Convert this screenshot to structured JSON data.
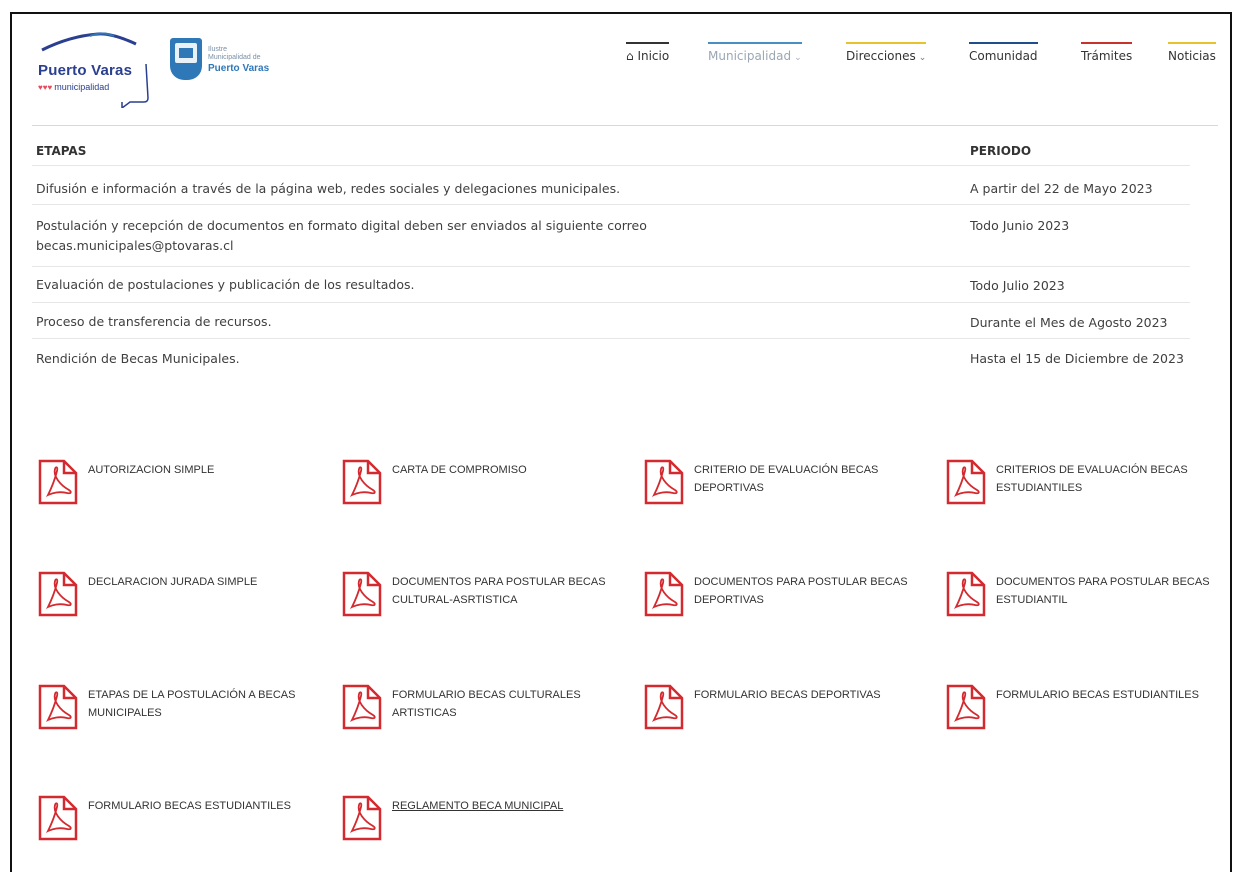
{
  "header": {
    "logo1": {
      "name": "Puerto Varas",
      "sub": "municipalidad"
    },
    "logo2": {
      "line1": "Ilustre",
      "line2": "Municipalidad de",
      "name": "Puerto Varas"
    },
    "nav": [
      {
        "label": "Inicio",
        "icon": "home-icon",
        "color": "#333333"
      },
      {
        "label": "Municipalidad",
        "dropdown": true,
        "color": "#4a8fc4"
      },
      {
        "label": "Direcciones",
        "dropdown": true,
        "color": "#e6c32a"
      },
      {
        "label": "Comunidad",
        "color": "#1f4e8c"
      },
      {
        "label": "Trámites",
        "color": "#c8322b"
      },
      {
        "label": "Noticias",
        "color": "#e6c32a"
      }
    ]
  },
  "table": {
    "headers": {
      "stages": "ETAPAS",
      "period": "PERIODO"
    },
    "rows": [
      {
        "stage": "Difusión e información a través de la página web, redes sociales y delegaciones municipales.",
        "period": "A partir del 22 de Mayo 2023"
      },
      {
        "stage": "Postulación y recepción de documentos en formato digital deben ser enviados al siguiente correo becas.municipales@ptovaras.cl",
        "period": "Todo Junio 2023"
      },
      {
        "stage": "Evaluación de postulaciones y publicación de los resultados.",
        "period": "Todo Julio 2023"
      },
      {
        "stage": "Proceso de transferencia de recursos.",
        "period": "Durante el Mes de Agosto 2023"
      },
      {
        "stage": "Rendición de Becas Municipales.",
        "period": "Hasta el 15 de Diciembre de 2023"
      }
    ]
  },
  "documents": [
    "AUTORIZACION SIMPLE",
    "CARTA DE COMPROMISO",
    "CRITERIO DE EVALUACIÓN BECAS DEPORTIVAS",
    "CRITERIOS DE EVALUACIÓN BECAS ESTUDIANTILES",
    "DECLARACION JURADA SIMPLE",
    "DOCUMENTOS PARA POSTULAR BECAS CULTURAL-ASRTISTICA",
    "DOCUMENTOS PARA POSTULAR BECAS DEPORTIVAS",
    "DOCUMENTOS PARA POSTULAR BECAS ESTUDIANTIL",
    "ETAPAS DE LA POSTULACIÓN A BECAS MUNICIPALES",
    "FORMULARIO BECAS CULTURALES ARTISTICAS",
    "FORMULARIO BECAS DEPORTIVAS",
    "FORMULARIO BECAS ESTUDIANTILES",
    "FORMULARIO BECAS ESTUDIANTILES",
    "REGLAMENTO BECA MUNICIPAL"
  ],
  "colors": {
    "pdf_red": "#d42a2f",
    "text": "#3a3a3a"
  }
}
